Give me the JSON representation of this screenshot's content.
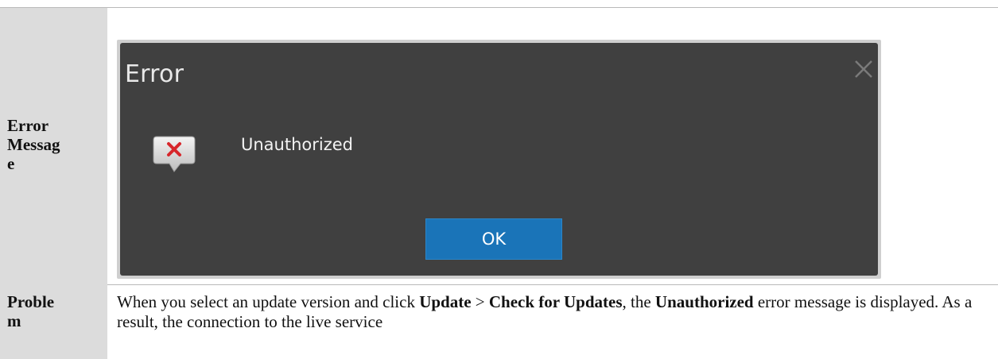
{
  "table": {
    "rows": [
      {
        "label": "Error Message"
      },
      {
        "label": "Problem"
      }
    ]
  },
  "dialog": {
    "title": "Error",
    "message": "Unauthorized",
    "ok_label": "OK"
  },
  "problem_text": {
    "p1": "When you select an update version and click ",
    "b1": "Update",
    "p2": " > ",
    "b2": "Check for Updates",
    "p3": ", the ",
    "b3": "Unauthorized",
    "p4": " error message is displayed. As a result, the connection to the live service"
  },
  "colors": {
    "dialog_bg": "#404040",
    "button_blue": "#1a74b8",
    "label_bg": "#dcdcdc",
    "error_red": "#d7262b"
  },
  "icons": [
    "close-icon",
    "error-icon"
  ]
}
